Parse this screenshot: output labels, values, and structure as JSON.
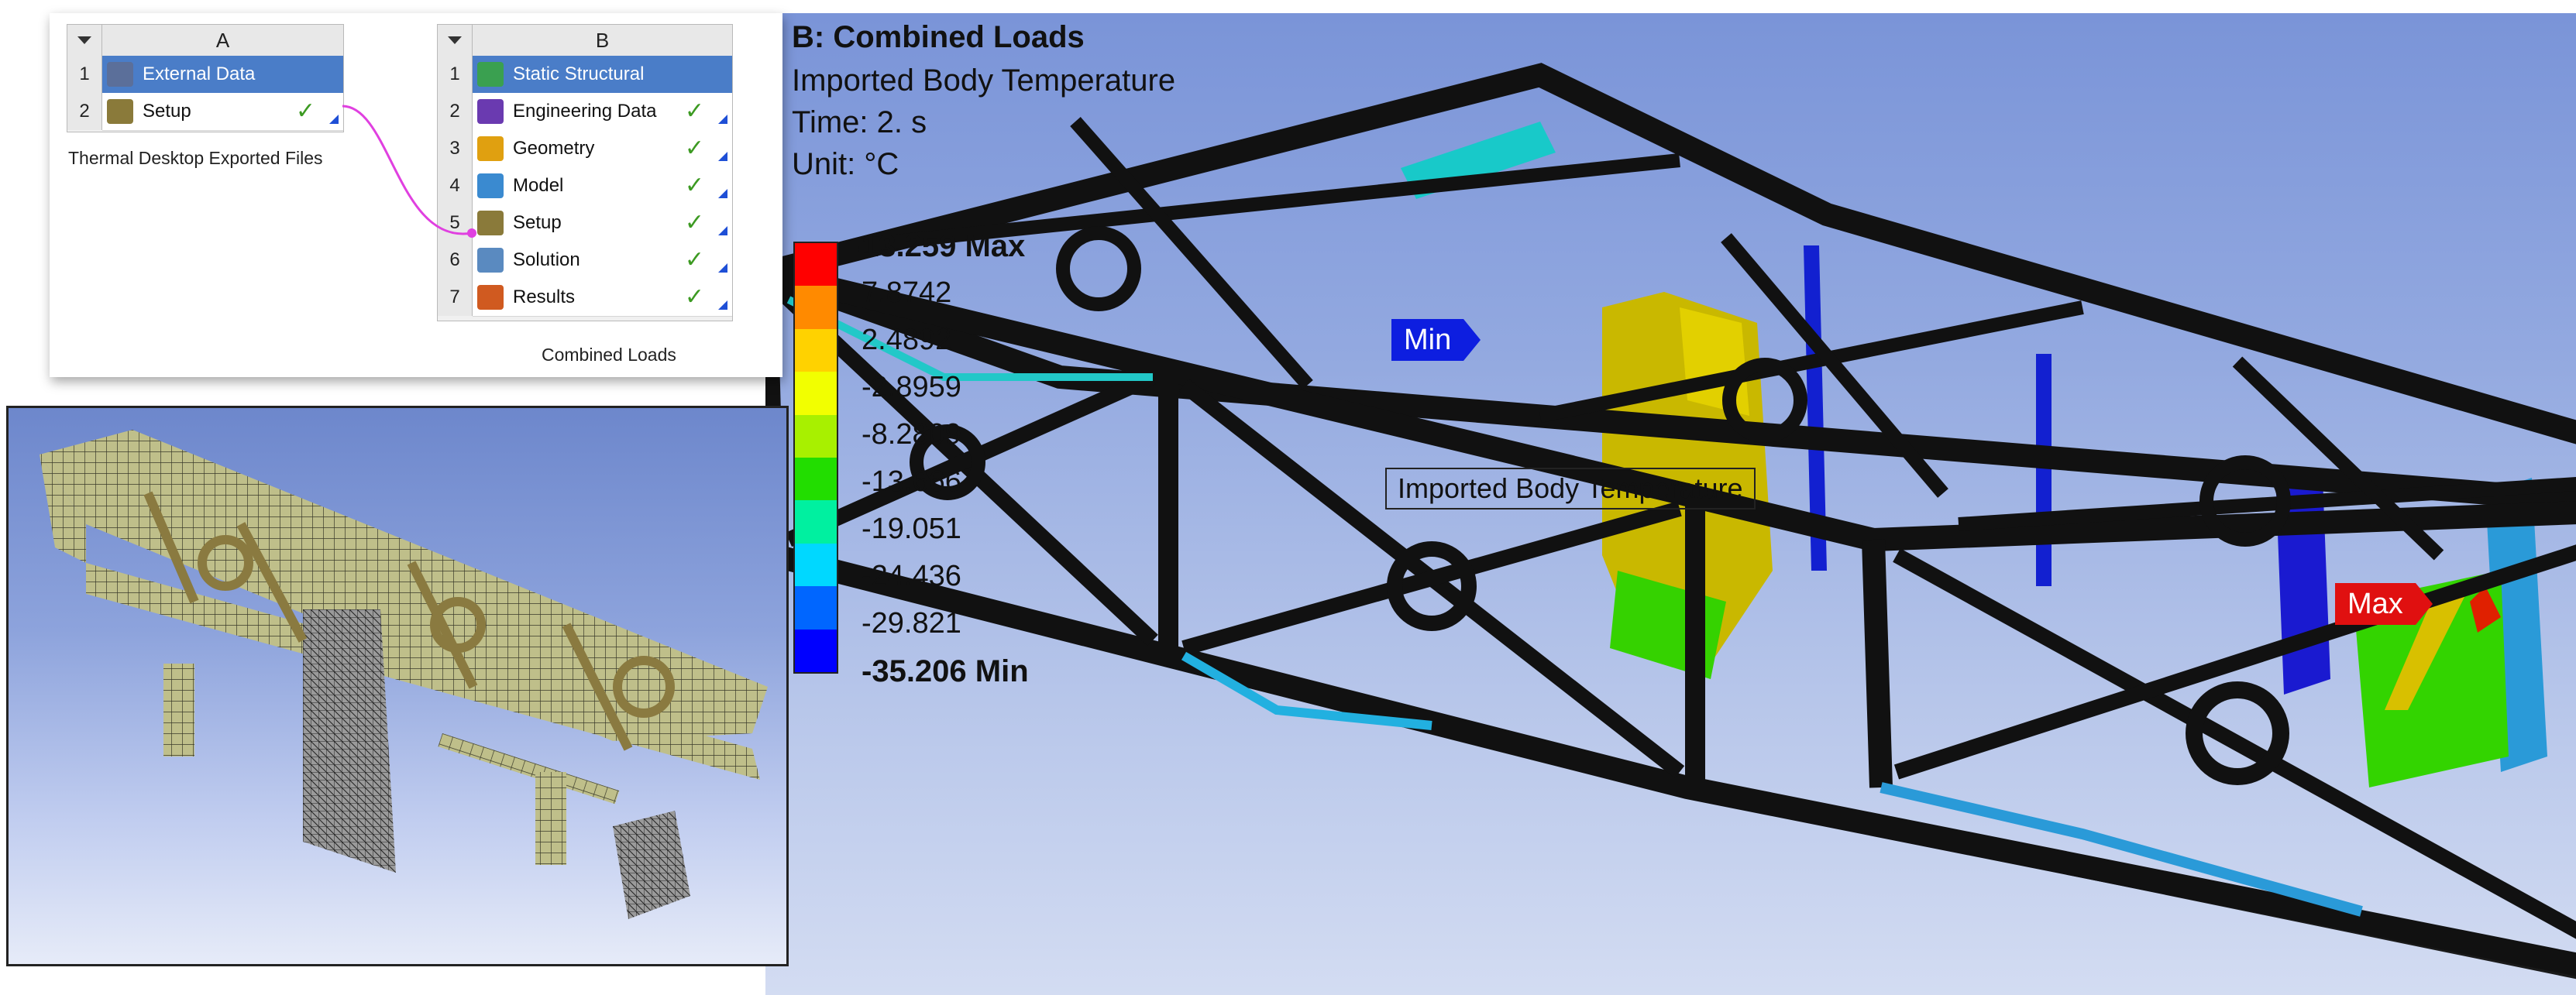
{
  "header": {
    "title": "B: Combined Loads",
    "variable": "Imported Body Temperature",
    "time": "Time: 2. s",
    "unit": "Unit: °C"
  },
  "legend": {
    "labels": [
      "13.259 Max",
      "7.8742",
      "2.4892",
      "-2.8959",
      "-8.2809",
      "-13.666",
      "-19.051",
      "-24.436",
      "-29.821",
      "-35.206 Min"
    ],
    "colors": [
      "#ff0000",
      "#ff8a00",
      "#ffd200",
      "#f2ff00",
      "#a8f000",
      "#22dd00",
      "#00f0a0",
      "#00d8ff",
      "#0066ff",
      "#0000ff"
    ]
  },
  "schematic": {
    "system_a": {
      "letter": "A",
      "rows": [
        {
          "num": "1",
          "label": "External Data",
          "icon": "external-data-icon",
          "selected": true,
          "check": false
        },
        {
          "num": "2",
          "label": "Setup",
          "icon": "setup-icon",
          "selected": false,
          "check": true
        }
      ],
      "caption": "Thermal Desktop Exported Files"
    },
    "system_b": {
      "letter": "B",
      "rows": [
        {
          "num": "1",
          "label": "Static Structural",
          "icon": "static-structural-icon",
          "selected": true,
          "check": false
        },
        {
          "num": "2",
          "label": "Engineering Data",
          "icon": "engineering-data-icon",
          "selected": false,
          "check": true
        },
        {
          "num": "3",
          "label": "Geometry",
          "icon": "geometry-icon",
          "selected": false,
          "check": true
        },
        {
          "num": "4",
          "label": "Model",
          "icon": "model-icon",
          "selected": false,
          "check": true
        },
        {
          "num": "5",
          "label": "Setup",
          "icon": "setup-icon",
          "selected": false,
          "check": true
        },
        {
          "num": "6",
          "label": "Solution",
          "icon": "solution-icon",
          "selected": false,
          "check": true
        },
        {
          "num": "7",
          "label": "Results",
          "icon": "results-icon",
          "selected": false,
          "check": true
        }
      ],
      "caption": "Combined Loads"
    },
    "check_glyph": "✓"
  },
  "probes": {
    "min": "Min",
    "max": "Max",
    "body": "Imported Body Temperature"
  },
  "colors": {
    "selected_row": "#4a7dc8",
    "frame": "#1a1a1a",
    "link": "#e040e0"
  }
}
